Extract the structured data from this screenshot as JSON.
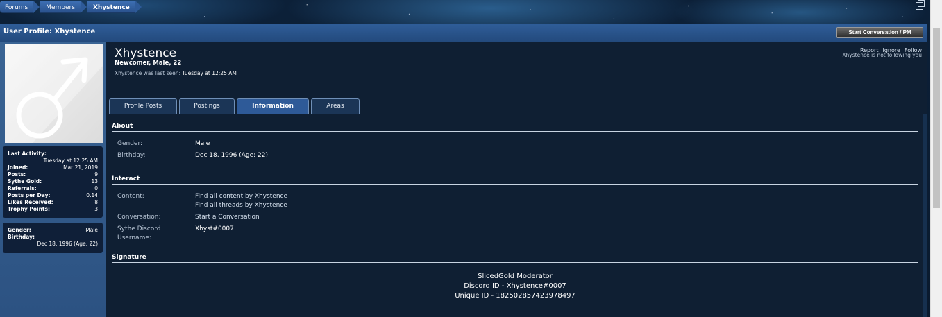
{
  "breadcrumb": [
    "Forums",
    "Members",
    "Xhystence"
  ],
  "header": {
    "title": "User Profile: Xhystence",
    "pm_button": "Start Conversation / PM"
  },
  "profile": {
    "name": "Xhystence",
    "title_line": "Newcomer, Male, 22",
    "last_seen_prefix": "Xhystence was last seen:",
    "last_seen_value": "Tuesday at 12:25 AM",
    "links": [
      "Report",
      "Ignore",
      "Follow"
    ],
    "following_note": "Xhystence is not following you"
  },
  "stats": {
    "last_activity_label": "Last Activity:",
    "last_activity_value": "Tuesday at 12:25 AM",
    "rows": [
      {
        "k": "Joined:",
        "v": "Mar 21, 2019"
      },
      {
        "k": "Posts:",
        "v": "9"
      },
      {
        "k": "Sythe Gold:",
        "v": "13"
      },
      {
        "k": "Referrals:",
        "v": "0"
      },
      {
        "k": "Posts per Day:",
        "v": "0.14"
      },
      {
        "k": "Likes Received:",
        "v": "8"
      },
      {
        "k": "Trophy Points:",
        "v": "3"
      }
    ]
  },
  "infobox": {
    "gender_label": "Gender:",
    "gender_value": "Male",
    "birthday_label": "Birthday:",
    "birthday_value": "Dec 18, 1996 (Age: 22)"
  },
  "tabs": [
    "Profile Posts",
    "Postings",
    "Information",
    "Areas"
  ],
  "about": {
    "heading": "About",
    "gender_label": "Gender:",
    "gender_value": "Male",
    "birthday_label": "Birthday:",
    "birthday_value": "Dec 18, 1996 (Age: 22)"
  },
  "interact": {
    "heading": "Interact",
    "content_label": "Content:",
    "content_link1": "Find all content by Xhystence",
    "content_link2": "Find all threads by Xhystence",
    "conversation_label": "Conversation:",
    "conversation_link": "Start a Conversation",
    "discord_label1": "Sythe Discord",
    "discord_label2": "Username:",
    "discord_value": "Xhyst#0007"
  },
  "signature": {
    "heading": "Signature",
    "lines": [
      "SlicedGold Moderator",
      "Discord ID - Xhystence#0007",
      "Unique ID - 182502857423978497"
    ]
  }
}
